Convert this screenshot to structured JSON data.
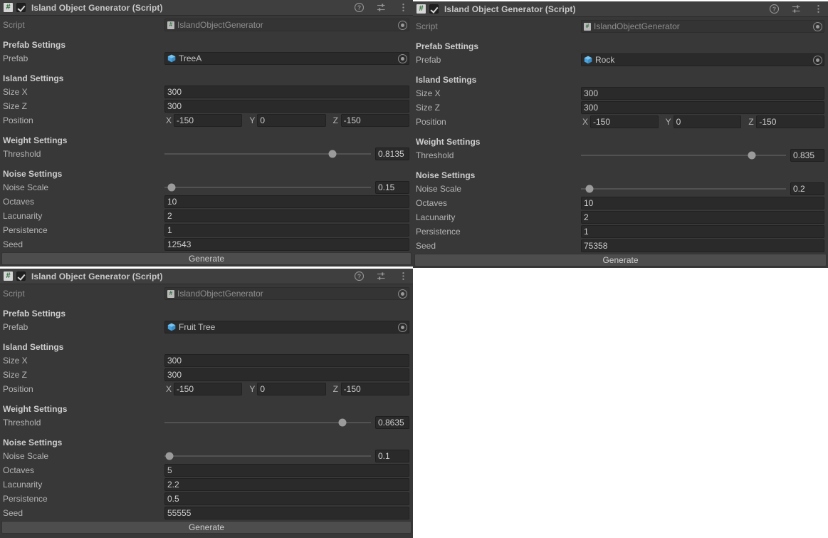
{
  "panels": [
    {
      "id": "tree-a",
      "header": {
        "title": "Island Object Generator (Script)",
        "script_glyph": "#",
        "enabled": true,
        "icons": [
          "help-icon",
          "preset-icon",
          "more-menu-icon"
        ]
      },
      "script_row": {
        "label": "Script",
        "value": "IslandObjectGenerator"
      },
      "prefab_section": {
        "title": "Prefab Settings",
        "label": "Prefab",
        "value": "TreeA"
      },
      "island_section": {
        "title": "Island Settings",
        "size_x": {
          "label": "Size X",
          "value": "300"
        },
        "size_z": {
          "label": "Size Z",
          "value": "300"
        },
        "position": {
          "label": "Position",
          "x_axis": "X",
          "x": "-150",
          "y_axis": "Y",
          "y": "0",
          "z_axis": "Z",
          "z": "-150"
        }
      },
      "weight_section": {
        "title": "Weight Settings",
        "threshold": {
          "label": "Threshold",
          "value": "0.8135",
          "percent": 81.35
        }
      },
      "noise_section": {
        "title": "Noise Settings",
        "noise_scale": {
          "label": "Noise Scale",
          "value": "0.15",
          "percent": 3.5
        },
        "octaves": {
          "label": "Octaves",
          "value": "10"
        },
        "lacunarity": {
          "label": "Lacunarity",
          "value": "2"
        },
        "persistence": {
          "label": "Persistence",
          "value": "1"
        },
        "seed": {
          "label": "Seed",
          "value": "12543"
        }
      },
      "generate_label": "Generate"
    },
    {
      "id": "rock",
      "header": {
        "title": "Island Object Generator (Script)",
        "script_glyph": "#",
        "enabled": true,
        "icons": [
          "help-icon",
          "preset-icon",
          "more-menu-icon"
        ]
      },
      "script_row": {
        "label": "Script",
        "value": "IslandObjectGenerator"
      },
      "prefab_section": {
        "title": "Prefab Settings",
        "label": "Prefab",
        "value": "Rock"
      },
      "island_section": {
        "title": "Island Settings",
        "size_x": {
          "label": "Size X",
          "value": "300"
        },
        "size_z": {
          "label": "Size Z",
          "value": "300"
        },
        "position": {
          "label": "Position",
          "x_axis": "X",
          "x": "-150",
          "y_axis": "Y",
          "y": "0",
          "z_axis": "Z",
          "z": "-150"
        }
      },
      "weight_section": {
        "title": "Weight Settings",
        "threshold": {
          "label": "Threshold",
          "value": "0.835",
          "percent": 83.5
        }
      },
      "noise_section": {
        "title": "Noise Settings",
        "noise_scale": {
          "label": "Noise Scale",
          "value": "0.2",
          "percent": 4.0
        },
        "octaves": {
          "label": "Octaves",
          "value": "10"
        },
        "lacunarity": {
          "label": "Lacunarity",
          "value": "2"
        },
        "persistence": {
          "label": "Persistence",
          "value": "1"
        },
        "seed": {
          "label": "Seed",
          "value": "75358"
        }
      },
      "generate_label": "Generate"
    },
    {
      "id": "fruit-tree",
      "header": {
        "title": "Island Object Generator (Script)",
        "script_glyph": "#",
        "enabled": true,
        "icons": [
          "help-icon",
          "preset-icon",
          "more-menu-icon"
        ]
      },
      "script_row": {
        "label": "Script",
        "value": "IslandObjectGenerator"
      },
      "prefab_section": {
        "title": "Prefab Settings",
        "label": "Prefab",
        "value": "Fruit Tree"
      },
      "island_section": {
        "title": "Island Settings",
        "size_x": {
          "label": "Size X",
          "value": "300"
        },
        "size_z": {
          "label": "Size Z",
          "value": "300"
        },
        "position": {
          "label": "Position",
          "x_axis": "X",
          "x": "-150",
          "y_axis": "Y",
          "y": "0",
          "z_axis": "Z",
          "z": "-150"
        }
      },
      "weight_section": {
        "title": "Weight Settings",
        "threshold": {
          "label": "Threshold",
          "value": "0.8635",
          "percent": 86.35
        }
      },
      "noise_section": {
        "title": "Noise Settings",
        "noise_scale": {
          "label": "Noise Scale",
          "value": "0.1",
          "percent": 2.4
        },
        "octaves": {
          "label": "Octaves",
          "value": "5"
        },
        "lacunarity": {
          "label": "Lacunarity",
          "value": "2.2"
        },
        "persistence": {
          "label": "Persistence",
          "value": "0.5"
        },
        "seed": {
          "label": "Seed",
          "value": "55555"
        }
      },
      "generate_label": "Generate"
    }
  ],
  "colors": {
    "panel_bg": "#383838",
    "header_bg": "#3f3f3f",
    "field_bg": "#2a2a2a",
    "button_bg": "#4d4d4d",
    "label_text": "#b4b4b4",
    "prefab_icon": "#4aa3df",
    "script_icon": "#2a6b35"
  }
}
